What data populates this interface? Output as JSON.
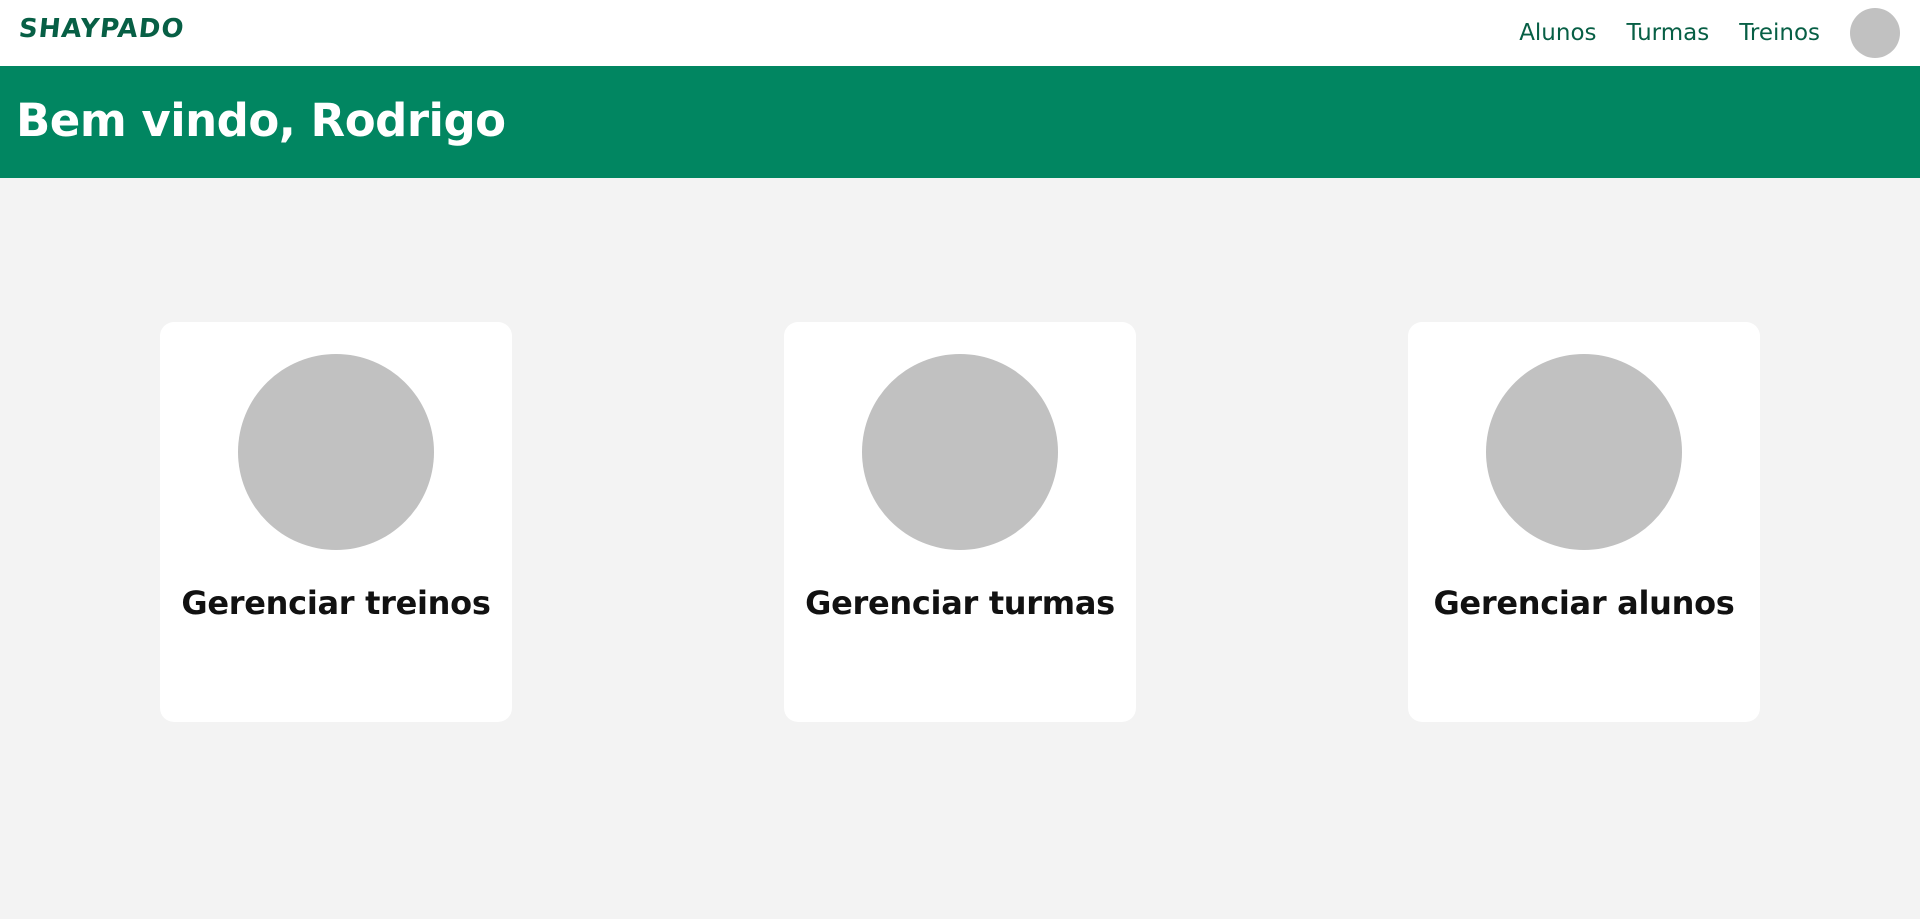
{
  "header": {
    "logo": "SHAYPADO",
    "nav": [
      {
        "label": "Alunos"
      },
      {
        "label": "Turmas"
      },
      {
        "label": "Treinos"
      }
    ],
    "avatar_icon": "user-avatar-icon"
  },
  "banner": {
    "title": "Bem vindo, Rodrigo"
  },
  "cards": [
    {
      "label": "Gerenciar treinos",
      "icon": "image-placeholder-icon"
    },
    {
      "label": "Gerenciar turmas",
      "icon": "image-placeholder-icon"
    },
    {
      "label": "Gerenciar alunos",
      "icon": "image-placeholder-icon"
    }
  ],
  "colors": {
    "brand_dark": "#075f45",
    "brand": "#018661",
    "background": "#f3f3f3",
    "placeholder": "#c1c1c1"
  }
}
